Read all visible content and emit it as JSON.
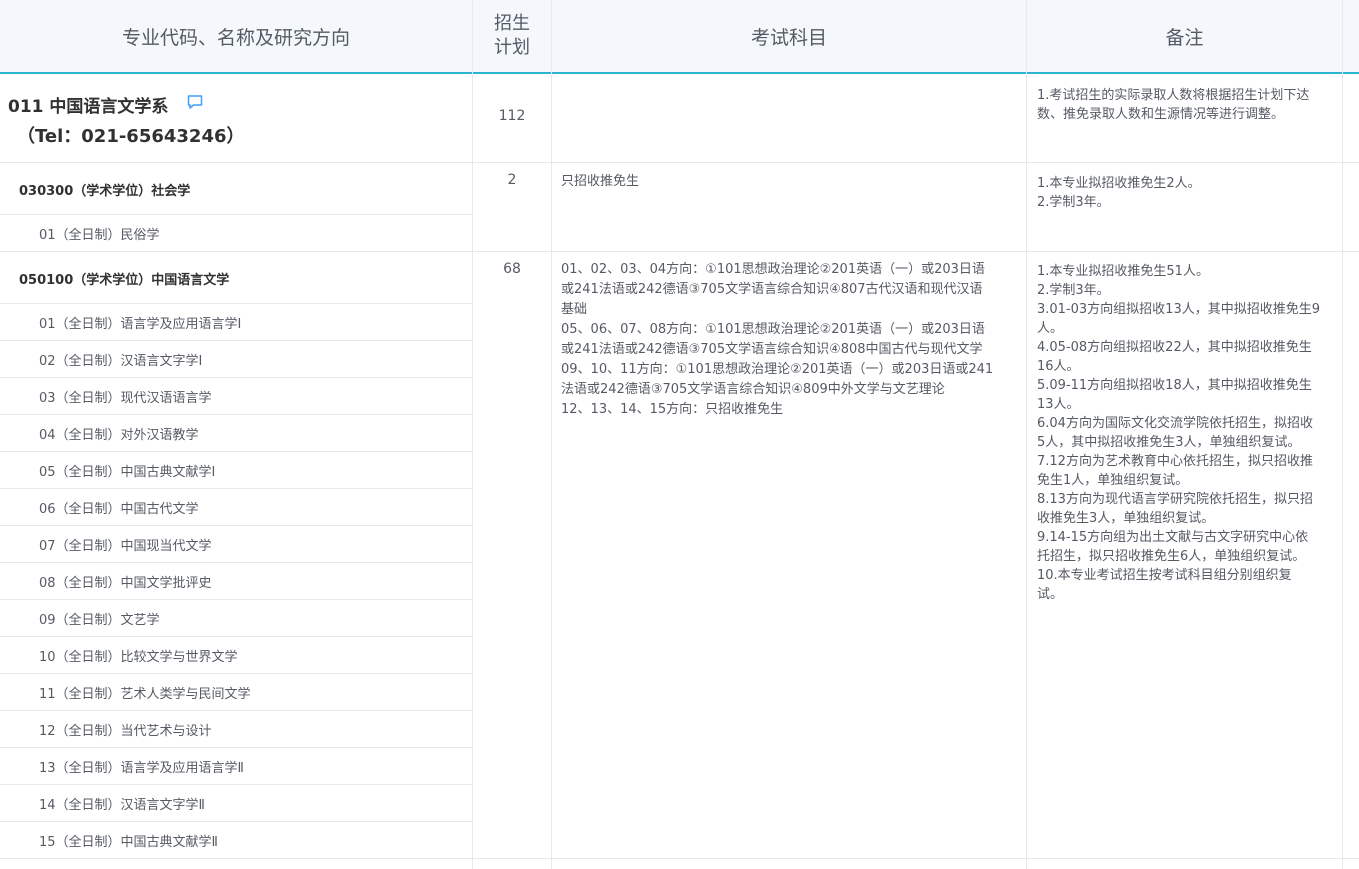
{
  "header": {
    "col_program": "专业代码、名称及研究方向",
    "col_plan_line1": "招生",
    "col_plan_line2": "计划",
    "col_exam": "考试科目",
    "col_notes": "备注"
  },
  "department": {
    "name": "011 中国语言文学系",
    "tel": "（Tel：021-65643246）",
    "plan": "112",
    "notes": [
      "1.考试招生的实际录取人数将根据招生计划下达",
      "数、推免录取人数和生源情况等进行调整。"
    ]
  },
  "majors": [
    {
      "title": "030300（学术学位）社会学",
      "plan": "2",
      "exam": [
        "只招收推免生"
      ],
      "notes": [
        "1.本专业拟招收推免生2人。",
        "2.学制3年。"
      ],
      "directions": [
        "01（全日制）民俗学"
      ]
    },
    {
      "title": "050100（学术学位）中国语言文学",
      "plan": "68",
      "exam": [
        "01、02、03、04方向：①101思想政治理论②201英语（一）或203日语",
        "或241法语或242德语③705文学语言综合知识④807古代汉语和现代汉语",
        "基础",
        "05、06、07、08方向：①101思想政治理论②201英语（一）或203日语",
        "或241法语或242德语③705文学语言综合知识④808中国古代与现代文学",
        "09、10、11方向：①101思想政治理论②201英语（一）或203日语或241",
        "法语或242德语③705文学语言综合知识④809中外文学与文艺理论",
        "12、13、14、15方向：只招收推免生"
      ],
      "notes": [
        "1.本专业拟招收推免生51人。",
        "2.学制3年。",
        "3.01-03方向组拟招收13人，其中拟招收推免生9",
        "人。",
        "4.05-08方向组拟招收22人，其中拟招收推免生",
        "16人。",
        "5.09-11方向组拟招收18人，其中拟招收推免生",
        "13人。",
        "6.04方向为国际文化交流学院依托招生，拟招收",
        "5人，其中拟招收推免生3人，单独组织复试。",
        "7.12方向为艺术教育中心依托招生，拟只招收推",
        "免生1人，单独组织复试。",
        "8.13方向为现代语言学研究院依托招生，拟只招",
        "收推免生3人，单独组织复试。",
        "9.14-15方向组为出土文献与古文字研究中心依",
        "托招生，拟只招收推免生6人，单独组织复试。",
        "10.本专业考试招生按考试科目组分别组织复",
        "试。"
      ],
      "directions": [
        "01（全日制）语言学及应用语言学Ⅰ",
        "02（全日制）汉语言文字学Ⅰ",
        "03（全日制）现代汉语语言学",
        "04（全日制）对外汉语教学",
        "05（全日制）中国古典文献学Ⅰ",
        "06（全日制）中国古代文学",
        "07（全日制）中国现当代文学",
        "08（全日制）中国文学批评史",
        "09（全日制）文艺学",
        "10（全日制）比较文学与世界文学",
        "11（全日制）艺术人类学与民间文学",
        "12（全日制）当代艺术与设计",
        "13（全日制）语言学及应用语言学Ⅱ",
        "14（全日制）汉语言文字学Ⅱ",
        "15（全日制）中国古典文献学Ⅱ"
      ]
    }
  ],
  "colors": {
    "accent": "#2bb5d0",
    "header_bg": "#f4f8fd",
    "icon": "#409eff"
  }
}
